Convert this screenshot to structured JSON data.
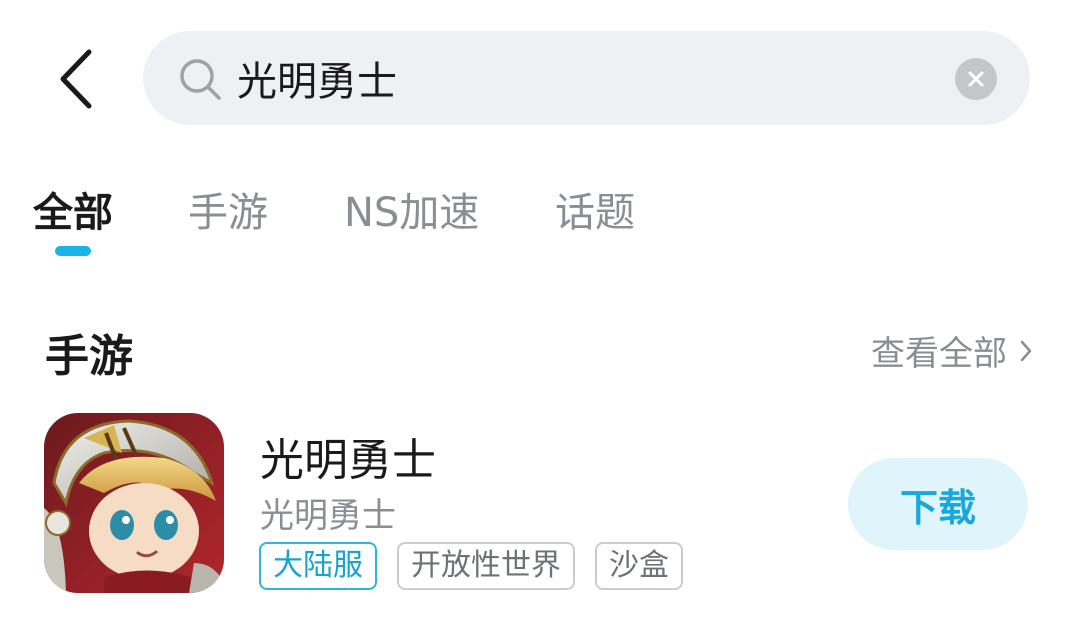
{
  "search": {
    "query": "光明勇士"
  },
  "tabs": [
    {
      "label": "全部",
      "active": true
    },
    {
      "label": "手游",
      "active": false
    },
    {
      "label": "NS加速",
      "active": false
    },
    {
      "label": "话题",
      "active": false
    }
  ],
  "section": {
    "title": "手游",
    "view_all_label": "查看全部"
  },
  "game": {
    "title": "光明勇士",
    "subtitle": "光明勇士",
    "tags": [
      "大陆服",
      "开放性世界",
      "沙盒"
    ],
    "download_label": "下载"
  },
  "colors": {
    "accent": "#19b4e8",
    "download_bg": "#dff4fb",
    "search_bg": "#eef0f3",
    "muted_text": "#8a8d93"
  },
  "icons": [
    "back-arrow-icon",
    "search-icon",
    "clear-icon",
    "chevron-right-icon"
  ]
}
